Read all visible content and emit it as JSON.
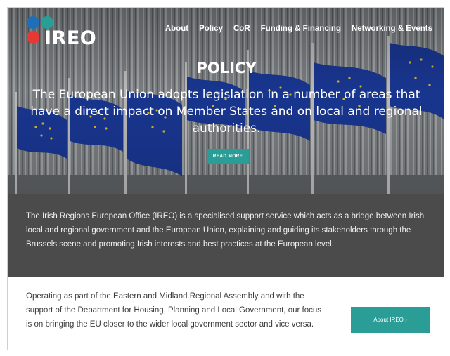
{
  "header": {
    "logo_text": "IREO",
    "nav": [
      {
        "label": "About"
      },
      {
        "label": "Policy"
      },
      {
        "label": "CoR"
      },
      {
        "label": "Funding & Financing"
      },
      {
        "label": "Networking & Events"
      }
    ]
  },
  "hero": {
    "title": "POLICY",
    "subtitle": "The European Union adopts legislation in a number of areas that have a direct impact on Member States and on local and regional authorities.",
    "button_label": "READ MORE"
  },
  "intro": {
    "text": "The Irish Regions European Office (IREO) is a specialised support service which acts as a bridge between Irish local and regional government and the European Union, explaining and guiding its stakeholders through the Brussels scene and promoting Irish interests and best practices at the European level."
  },
  "about": {
    "text": "Operating as part of the Eastern and Midland Regional Assembly and with the support of the Department for Housing, Planning and Local Government, our focus is on bringing the EU closer to the wider local government sector and vice versa.",
    "button_label": "About IREO ›"
  },
  "colors": {
    "accent": "#2a9d96",
    "band": "#4b4b4b",
    "logo_blue": "#1f6fb8",
    "logo_teal": "#2a9d96",
    "logo_red": "#e53935",
    "flag_blue": "#1d3fa8",
    "flag_star": "#f7d22a"
  }
}
